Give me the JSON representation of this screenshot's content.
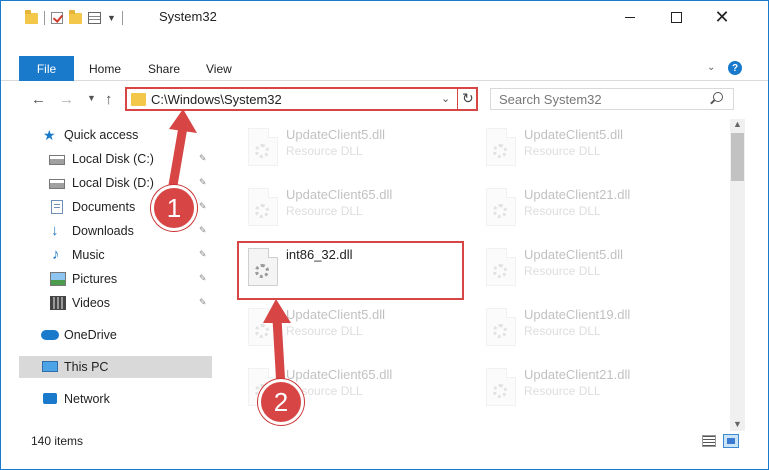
{
  "window": {
    "title": "System32",
    "controls": {
      "minimize": "",
      "maximize": "",
      "close": "✕"
    }
  },
  "ribbon": {
    "tabs": [
      "File",
      "Home",
      "Share",
      "View"
    ],
    "help": "?"
  },
  "navbar": {
    "address": "C:\\Windows\\System32",
    "search_placeholder": "Search System32"
  },
  "sidebar": {
    "items": [
      {
        "label": "Quick access",
        "icon": "star-icon",
        "pinned": false
      },
      {
        "label": "Local Disk (C:)",
        "icon": "drive-icon",
        "pinned": true
      },
      {
        "label": "Local Disk (D:)",
        "icon": "drive-icon",
        "pinned": true
      },
      {
        "label": "Documents",
        "icon": "documents-icon",
        "pinned": true
      },
      {
        "label": "Downloads",
        "icon": "download-icon",
        "pinned": true
      },
      {
        "label": "Music",
        "icon": "music-icon",
        "pinned": true
      },
      {
        "label": "Pictures",
        "icon": "pictures-icon",
        "pinned": true
      },
      {
        "label": "Videos",
        "icon": "videos-icon",
        "pinned": true
      },
      {
        "label": "OneDrive",
        "icon": "cloud-icon",
        "pinned": false
      },
      {
        "label": "This PC",
        "icon": "computer-icon",
        "pinned": false,
        "selected": true
      },
      {
        "label": "Network",
        "icon": "network-icon",
        "pinned": false
      }
    ]
  },
  "files": {
    "left": [
      {
        "name": "UpdateClient5.dll",
        "type": "Resource DLL"
      },
      {
        "name": "UpdateClient65.dll",
        "type": "Resource DLL"
      },
      {
        "name": "int86_32.dll",
        "type": ""
      },
      {
        "name": "UpdateClient5.dll",
        "type": "Resource DLL"
      },
      {
        "name": "UpdateClient65.dll",
        "type": "Resource DLL"
      }
    ],
    "right": [
      {
        "name": "UpdateClient5.dll",
        "type": "Resource DLL"
      },
      {
        "name": "UpdateClient21.dll",
        "type": "Resource DLL"
      },
      {
        "name": "UpdateClient5.dll",
        "type": "Resource DLL"
      },
      {
        "name": "UpdateClient19.dll",
        "type": "Resource DLL"
      },
      {
        "name": "UpdateClient21.dll",
        "type": "Resource DLL"
      }
    ]
  },
  "status": {
    "item_count": "140 items"
  },
  "annotations": {
    "step1": "1",
    "step2": "2",
    "color": "#d74545"
  }
}
